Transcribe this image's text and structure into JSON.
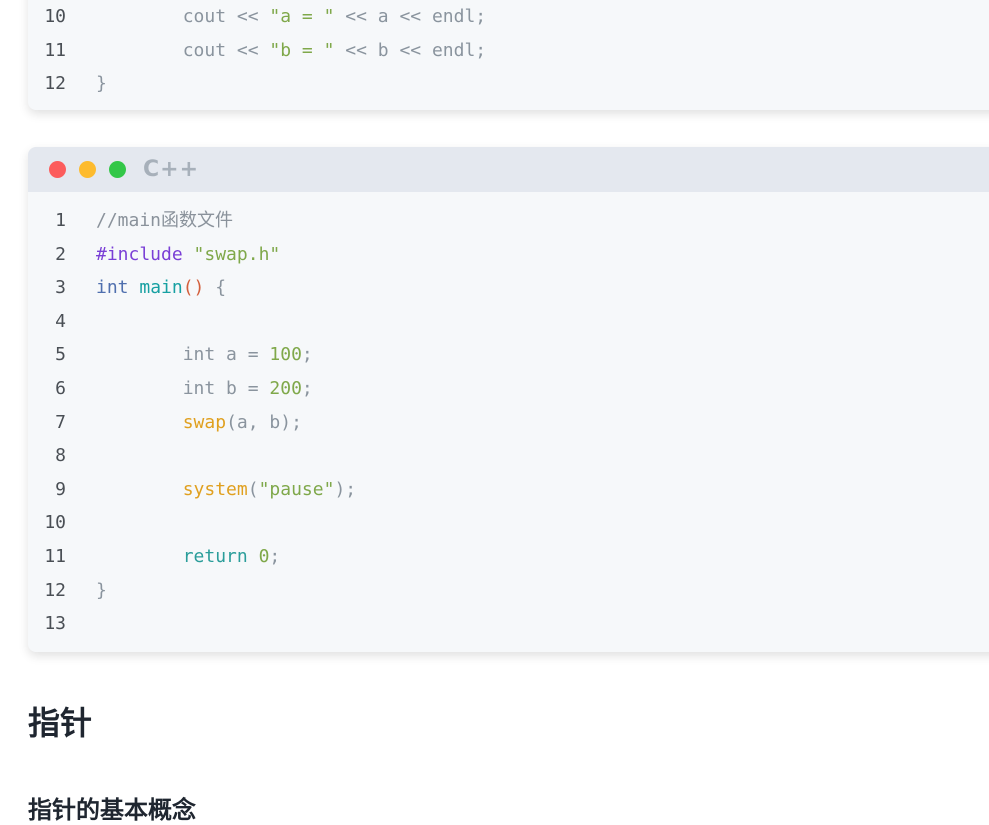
{
  "block1": {
    "lines": [
      {
        "n": "10",
        "tokens": [
          [
            "plain",
            "        cout << "
          ],
          [
            "str",
            "\"a = \""
          ],
          [
            "plain",
            " << a << endl;"
          ]
        ]
      },
      {
        "n": "11",
        "tokens": [
          [
            "plain",
            "        cout << "
          ],
          [
            "str",
            "\"b = \""
          ],
          [
            "plain",
            " << b << endl;"
          ]
        ]
      },
      {
        "n": "12",
        "tokens": [
          [
            "plain",
            "}"
          ]
        ]
      }
    ]
  },
  "block2": {
    "lang": "C++",
    "lines": [
      {
        "n": "1",
        "tokens": [
          [
            "cm",
            "//main函数文件"
          ]
        ]
      },
      {
        "n": "2",
        "tokens": [
          [
            "pre",
            "#include "
          ],
          [
            "str",
            "\"swap.h\""
          ]
        ]
      },
      {
        "n": "3",
        "tokens": [
          [
            "kw",
            "int "
          ],
          [
            "fn",
            "main"
          ],
          [
            "paren",
            "()"
          ],
          [
            "plain",
            " {"
          ]
        ]
      },
      {
        "n": "4",
        "tokens": []
      },
      {
        "n": "5",
        "tokens": [
          [
            "plain",
            "        int a = "
          ],
          [
            "num",
            "100"
          ],
          [
            "plain",
            ";"
          ]
        ]
      },
      {
        "n": "6",
        "tokens": [
          [
            "plain",
            "        int b = "
          ],
          [
            "num",
            "200"
          ],
          [
            "plain",
            ";"
          ]
        ]
      },
      {
        "n": "7",
        "tokens": [
          [
            "plain",
            "        "
          ],
          [
            "call",
            "swap"
          ],
          [
            "plain",
            "(a, b);"
          ]
        ]
      },
      {
        "n": "8",
        "tokens": []
      },
      {
        "n": "9",
        "tokens": [
          [
            "plain",
            "        "
          ],
          [
            "call",
            "system"
          ],
          [
            "plain",
            "("
          ],
          [
            "str",
            "\"pause\""
          ],
          [
            "plain",
            ");"
          ]
        ]
      },
      {
        "n": "10",
        "tokens": []
      },
      {
        "n": "11",
        "tokens": [
          [
            "plain",
            "        "
          ],
          [
            "ret",
            "return "
          ],
          [
            "num",
            "0"
          ],
          [
            "plain",
            ";"
          ]
        ]
      },
      {
        "n": "12",
        "tokens": [
          [
            "plain",
            "}"
          ]
        ]
      },
      {
        "n": "13",
        "tokens": []
      }
    ]
  },
  "heading": "指针",
  "subheading": "指针的基本概念"
}
